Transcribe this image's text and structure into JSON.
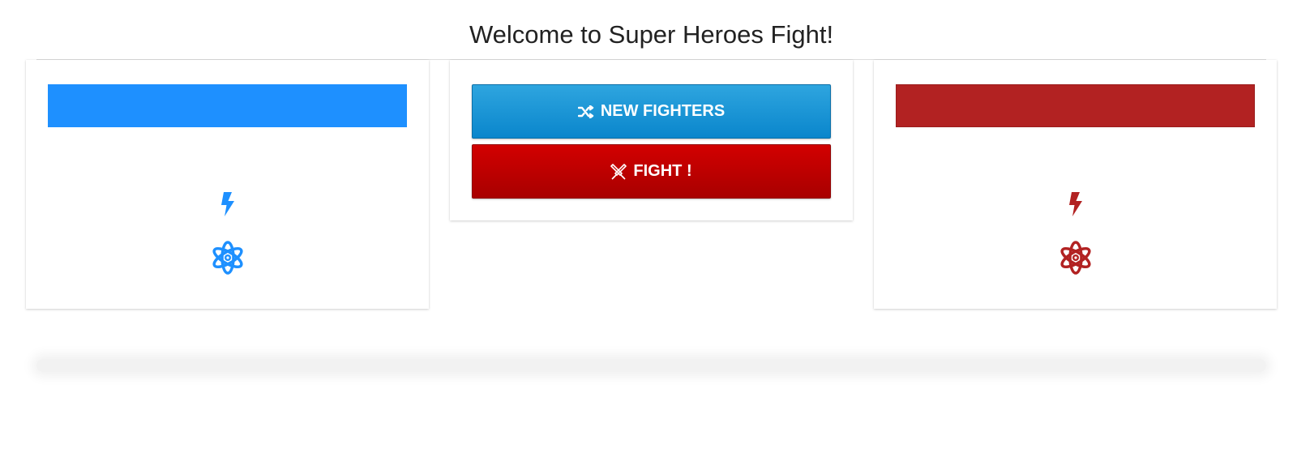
{
  "page": {
    "title": "Welcome to Super Heroes Fight!"
  },
  "hero_left": {
    "bar_color": "#1e90ff",
    "power_icon": "lightning-bolt-icon",
    "level_icon": "atom-icon",
    "icon_color": "#1e90ff"
  },
  "hero_right": {
    "bar_color": "#b22222",
    "power_icon": "lightning-bolt-icon",
    "level_icon": "atom-icon",
    "icon_color": "#b22222"
  },
  "controls": {
    "new_fighters_label": "NEW FIGHTERS",
    "new_fighters_icon": "shuffle-icon",
    "fight_label": "FIGHT !",
    "fight_icon": "swords-icon"
  }
}
